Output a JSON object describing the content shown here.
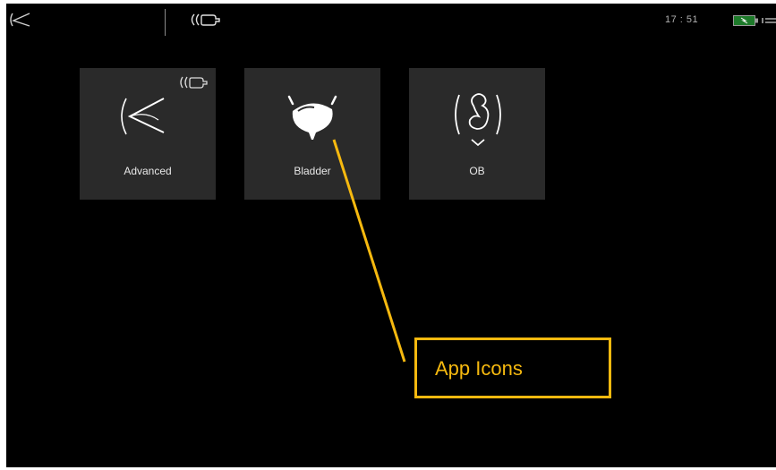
{
  "status_bar": {
    "logo_icon": "probe-arc-icon",
    "probe_status_icon": "wireless-probe-icon",
    "time": "17 : 51",
    "battery_icon": "battery-charging-icon"
  },
  "apps": [
    {
      "label": "Advanced",
      "icon": "advanced-scan-icon",
      "badge_icon": "wireless-probe-icon"
    },
    {
      "label": "Bladder",
      "icon": "bladder-icon"
    },
    {
      "label": "OB",
      "icon": "fetus-icon"
    }
  ],
  "callout": {
    "text": "App Icons",
    "color": "#f6b90f"
  },
  "colors": {
    "screen_background": "#000000",
    "tile_background": "#2a2a2a",
    "label_text": "#e8e8e8"
  }
}
